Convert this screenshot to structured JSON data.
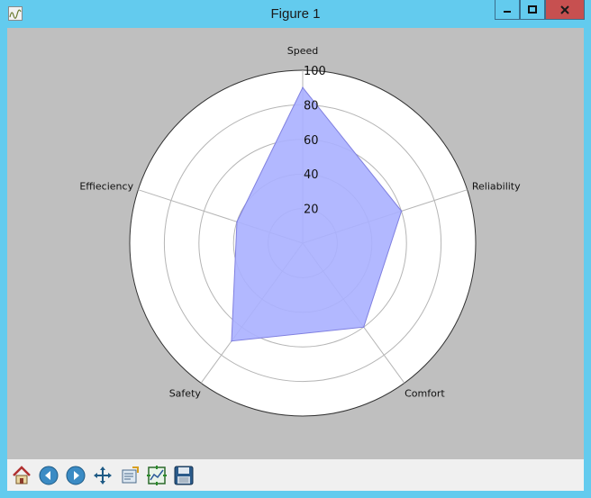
{
  "window": {
    "title": "Figure 1",
    "controls": {
      "minimize": "minimize",
      "maximize": "maximize",
      "close": "close"
    }
  },
  "colors": {
    "titlebar": "#63cbee",
    "plot_background": "#bfbfbf",
    "polar_background": "#ffffff",
    "fill": "#aab0ff",
    "edge": "#8080e0",
    "close_button": "#c75050",
    "toolbar": "#f0f0f0"
  },
  "toolbar": {
    "tools": [
      {
        "name": "home",
        "icon": "home-icon"
      },
      {
        "name": "back",
        "icon": "back-arrow-icon"
      },
      {
        "name": "forward",
        "icon": "forward-arrow-icon"
      },
      {
        "name": "pan",
        "icon": "pan-arrows-icon"
      },
      {
        "name": "zoom",
        "icon": "zoom-rect-icon"
      },
      {
        "name": "subplots",
        "icon": "subplots-icon"
      },
      {
        "name": "save",
        "icon": "save-disk-icon"
      }
    ]
  },
  "chart_data": {
    "type": "radar",
    "categories": [
      "Speed",
      "Reliability",
      "Comfort",
      "Safety",
      "Effieciency"
    ],
    "values": [
      90,
      60,
      60,
      70,
      40
    ],
    "radial_ticks": [
      "20",
      "40",
      "60",
      "80",
      "100"
    ],
    "rlim": [
      0,
      100
    ],
    "grid": true,
    "legend": "none"
  }
}
